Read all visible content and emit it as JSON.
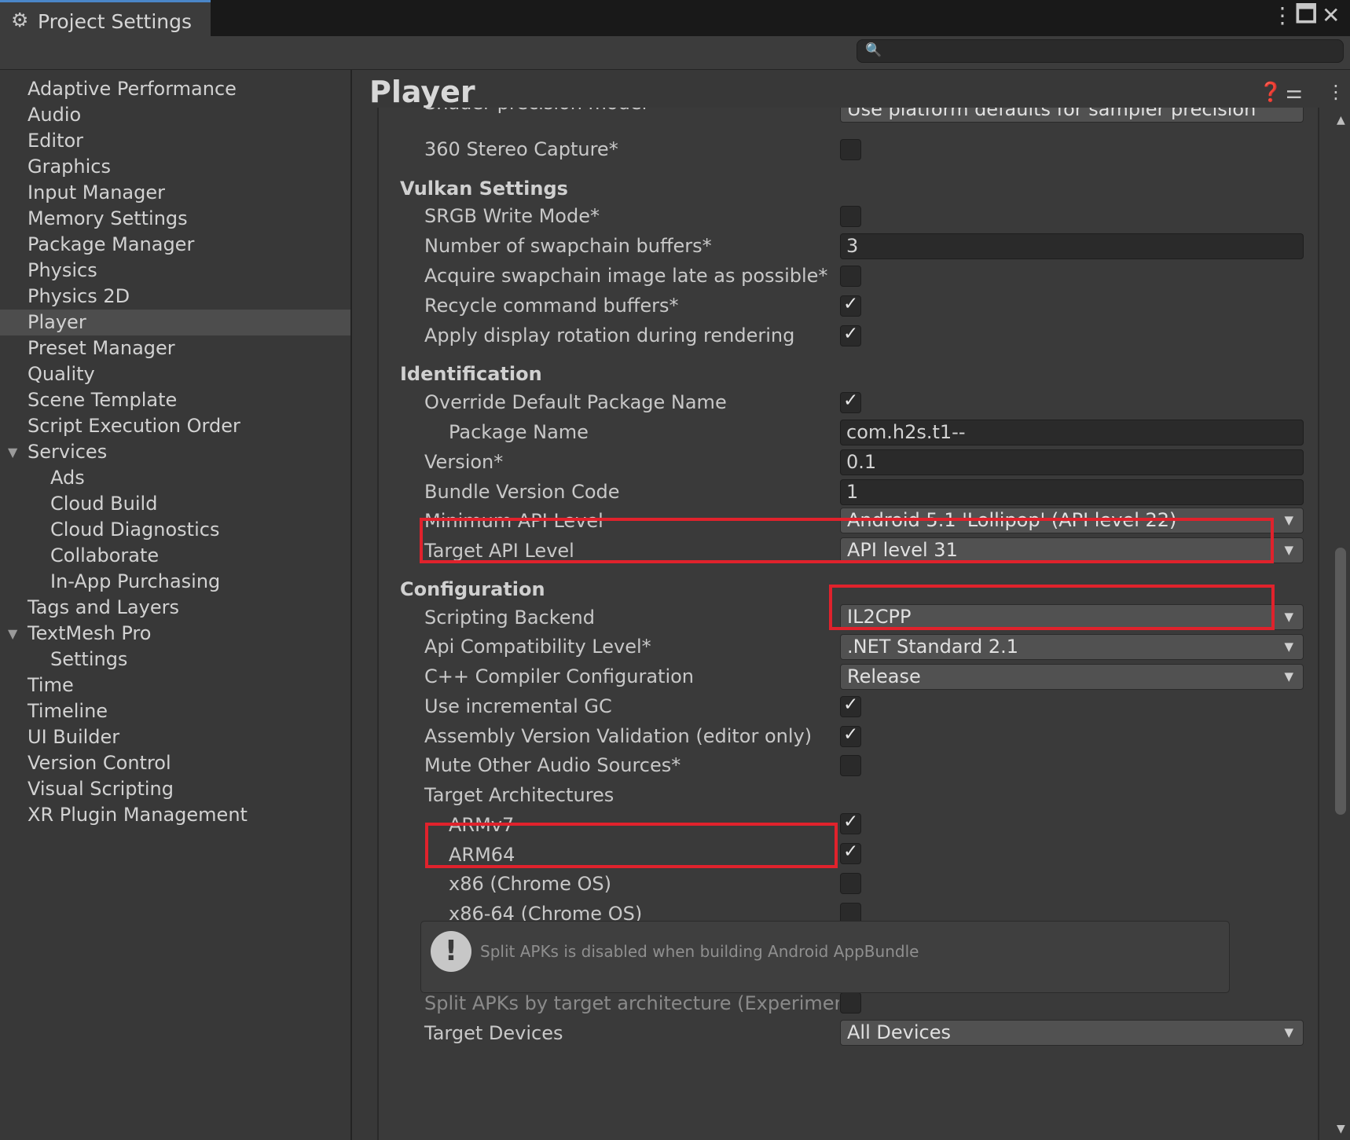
{
  "window": {
    "tab_title": "Project Settings",
    "search_placeholder": ""
  },
  "sidebar": {
    "items": [
      {
        "label": "Adaptive Performance"
      },
      {
        "label": "Audio"
      },
      {
        "label": "Editor"
      },
      {
        "label": "Graphics"
      },
      {
        "label": "Input Manager"
      },
      {
        "label": "Memory Settings"
      },
      {
        "label": "Package Manager"
      },
      {
        "label": "Physics"
      },
      {
        "label": "Physics 2D"
      },
      {
        "label": "Player",
        "selected": true
      },
      {
        "label": "Preset Manager"
      },
      {
        "label": "Quality"
      },
      {
        "label": "Scene Template"
      },
      {
        "label": "Script Execution Order"
      },
      {
        "label": "Services",
        "expanded": true
      },
      {
        "label": "Ads"
      },
      {
        "label": "Cloud Build"
      },
      {
        "label": "Cloud Diagnostics"
      },
      {
        "label": "Collaborate"
      },
      {
        "label": "In-App Purchasing"
      },
      {
        "label": "Tags and Layers"
      },
      {
        "label": "TextMesh Pro",
        "expanded": true
      },
      {
        "label": "Settings"
      },
      {
        "label": "Time"
      },
      {
        "label": "Timeline"
      },
      {
        "label": "UI Builder"
      },
      {
        "label": "Version Control"
      },
      {
        "label": "Visual Scripting"
      },
      {
        "label": "XR Plugin Management"
      }
    ]
  },
  "main": {
    "title": "Player",
    "partial_top_label": "Shader precision model",
    "partial_top_value": "Use platform defaults for sampler precision",
    "stereo_capture": {
      "label": "360 Stereo Capture*",
      "checked": false
    },
    "vulkan": {
      "heading": "Vulkan Settings",
      "srgb_write": {
        "label": "SRGB Write Mode*",
        "checked": false
      },
      "swapchain_buffers": {
        "label": "Number of swapchain buffers*",
        "value": "3"
      },
      "acquire_late": {
        "label": "Acquire swapchain image late as possible*",
        "checked": false
      },
      "recycle_buffers": {
        "label": "Recycle command buffers*",
        "checked": true
      },
      "display_rotation": {
        "label": "Apply display rotation during rendering",
        "checked": true
      }
    },
    "identification": {
      "heading": "Identification",
      "override_package": {
        "label": "Override Default Package Name",
        "checked": true
      },
      "package_name": {
        "label": "Package Name",
        "value": "com.h2s.t1--"
      },
      "version": {
        "label": "Version*",
        "value": "0.1"
      },
      "bundle_code": {
        "label": "Bundle Version Code",
        "value": "1"
      },
      "min_api": {
        "label": "Minimum API Level",
        "value": "Android 5.1 'Lollipop' (API level 22)"
      },
      "target_api": {
        "label": "Target API Level",
        "value": "API level 31"
      }
    },
    "configuration": {
      "heading": "Configuration",
      "scripting_backend": {
        "label": "Scripting Backend",
        "value": "IL2CPP"
      },
      "api_compat": {
        "label": "Api Compatibility Level*",
        "value": ".NET Standard 2.1"
      },
      "cpp_config": {
        "label": "C++ Compiler Configuration",
        "value": "Release"
      },
      "incremental_gc": {
        "label": "Use incremental GC",
        "checked": true
      },
      "assembly_validation": {
        "label": "Assembly Version Validation (editor only)",
        "checked": true
      },
      "mute_audio": {
        "label": "Mute Other Audio Sources*",
        "checked": false
      },
      "target_arch": {
        "label": "Target Architectures",
        "armv7": {
          "label": "ARMv7",
          "checked": true
        },
        "arm64": {
          "label": "ARM64",
          "checked": true
        },
        "x86": {
          "label": "x86 (Chrome OS)",
          "checked": false
        },
        "x86_64": {
          "label": "x86-64 (Chrome OS)",
          "checked": false
        }
      },
      "split_apk_info": "Split APKs is disabled when building Android AppBundle",
      "split_apks": {
        "label": "Split APKs by target architecture (Experimenta",
        "checked": false
      },
      "target_devices": {
        "label": "Target Devices",
        "value": "All Devices"
      }
    }
  },
  "colors": {
    "highlight_box": "#e0222c",
    "tab_accent": "#4a86c8",
    "selected_row": "#4d4d4d"
  }
}
